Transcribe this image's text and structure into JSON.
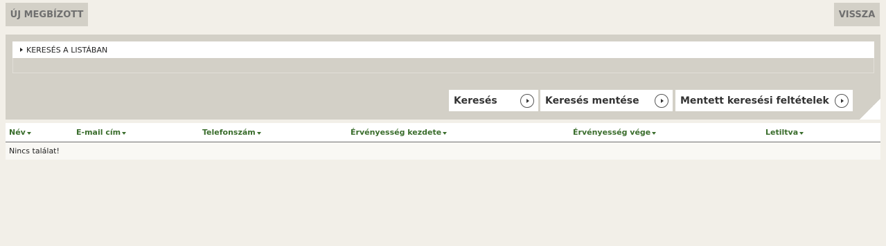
{
  "toolbar": {
    "new_label": "ÚJ MEGBÍZOTT",
    "back_label": "VISSZA"
  },
  "search_panel": {
    "header_label": "KERESÉS A LISTÁBAN",
    "buttons": {
      "search": "Keresés",
      "save_search": "Keresés mentése",
      "saved_criteria": "Mentett keresési feltételek"
    }
  },
  "table": {
    "columns": [
      "Név",
      "E-mail cím",
      "Telefonszám",
      "Érvényesség kezdete",
      "Érvényesség vége",
      "Letiltva"
    ],
    "empty_message": "Nincs találat!"
  },
  "colors": {
    "background": "#f2efe8",
    "panel": "#d3d0c7",
    "header_text": "#3a6d2c"
  }
}
